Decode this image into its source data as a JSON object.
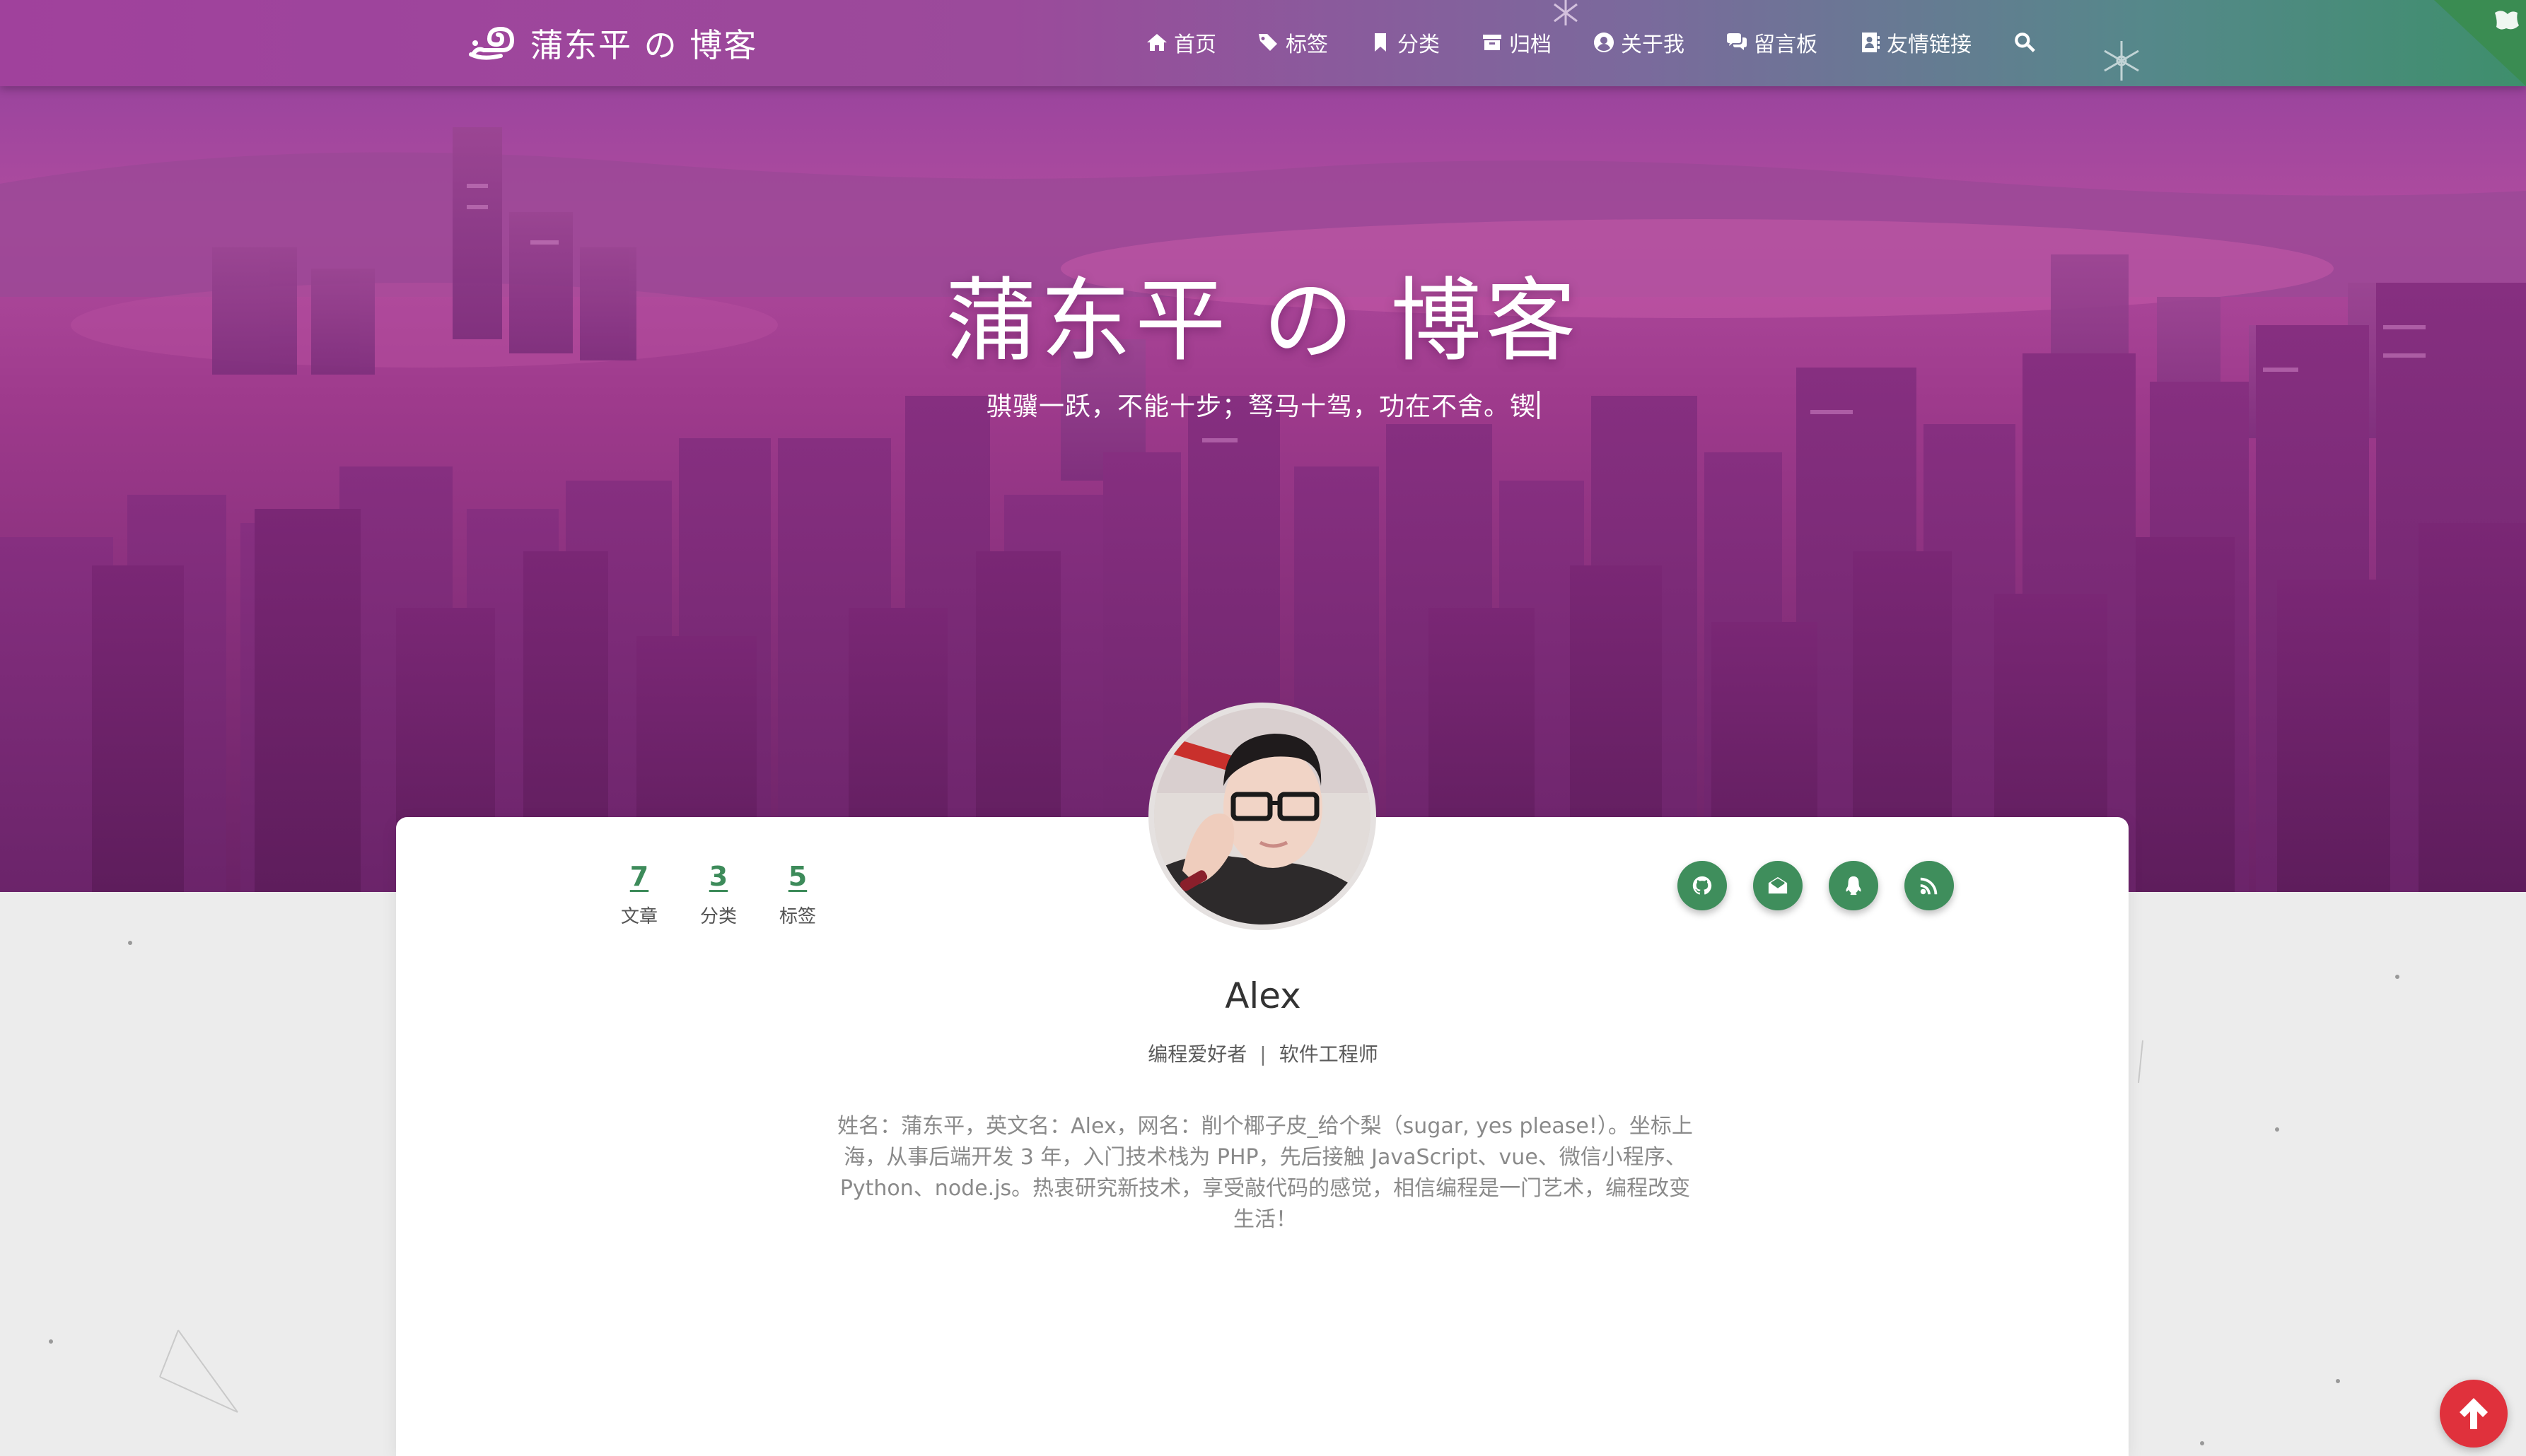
{
  "brand": {
    "name": "蒲东平 の 博客"
  },
  "nav": {
    "items": [
      {
        "label": "首页",
        "icon": "home-icon"
      },
      {
        "label": "标签",
        "icon": "tags-icon"
      },
      {
        "label": "分类",
        "icon": "bookmark-icon"
      },
      {
        "label": "归档",
        "icon": "archive-icon"
      },
      {
        "label": "关于我",
        "icon": "user-circle-icon"
      },
      {
        "label": "留言板",
        "icon": "comments-icon"
      },
      {
        "label": "友情链接",
        "icon": "address-book-icon"
      }
    ],
    "search_icon": "search-icon"
  },
  "hero": {
    "title": "蒲东平 の 博客",
    "subtitle": "骐骥一跃，不能十步；驽马十驾，功在不舍。锲"
  },
  "profile": {
    "stats": [
      {
        "value": "7",
        "label": "文章"
      },
      {
        "value": "3",
        "label": "分类"
      },
      {
        "value": "5",
        "label": "标签"
      }
    ],
    "socials": [
      "github-icon",
      "email-icon",
      "qq-icon",
      "rss-icon"
    ],
    "name": "Alex",
    "role_1": "编程爱好者",
    "role_separator": "|",
    "role_2": "软件工程师",
    "bio": "姓名：蒲东平，英文名：Alex，网名：削个椰子皮_给个梨（sugar, yes please!）。坐标上海，从事后端开发 3 年，入门技术栈为 PHP，先后接触 JavaScript、vue、微信小程序、Python、node.js。热衷研究新技术，享受敲代码的感觉，相信编程是一门艺术，编程改变生活！"
  },
  "colors": {
    "accent_green": "#3f8e5c",
    "stat_green": "#3d8b5a",
    "back_top_red": "#e0313c"
  }
}
